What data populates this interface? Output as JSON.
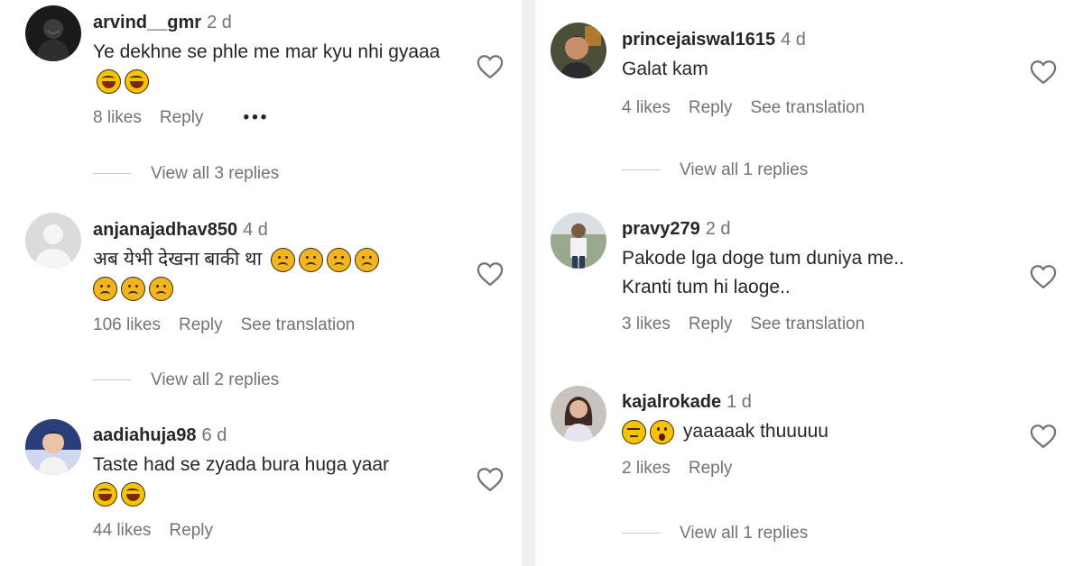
{
  "left": {
    "comments": [
      {
        "username": "arvind__gmr",
        "time": "2 d",
        "text": "Ye dekhne se phle me mar kyu nhi gyaaa",
        "emojis": [
          "laugh-emoji",
          "laugh-emoji"
        ],
        "likes": "8 likes",
        "reply": "Reply",
        "more": "•••",
        "view_replies": "View all 3 replies"
      },
      {
        "username": "anjanajadhav850",
        "time": "4 d",
        "text": "अब येभी देखना बाकी था",
        "emojis": [
          "sad-emoji",
          "sad-emoji",
          "sad-emoji",
          "sad-emoji",
          "sad-emoji",
          "sad-emoji",
          "sad-emoji"
        ],
        "likes": "106 likes",
        "reply": "Reply",
        "see_translation": "See translation",
        "view_replies": "View all 2 replies"
      },
      {
        "username": "aadiahuja98",
        "time": "6 d",
        "text": "Taste had se zyada bura huga yaar",
        "emojis": [
          "laugh-emoji",
          "laugh-emoji"
        ],
        "likes": "44 likes",
        "reply": "Reply"
      }
    ]
  },
  "right": {
    "comments": [
      {
        "username": "princejaiswal1615",
        "time": "4 d",
        "text": "Galat kam",
        "likes": "4 likes",
        "reply": "Reply",
        "see_translation": "See translation",
        "view_replies": "View all 1 replies"
      },
      {
        "username": "pravy279",
        "time": "2 d",
        "text_line1": "Pakode lga doge tum duniya me..",
        "text_line2": "Kranti tum hi laoge..",
        "likes": "3 likes",
        "reply": "Reply",
        "see_translation": "See translation"
      },
      {
        "username": "kajalrokade",
        "time": "1 d",
        "text": "yaaaaak thuuuuu",
        "emojis": [
          "unamused-emoji",
          "hushed-emoji"
        ],
        "likes": "2 likes",
        "reply": "Reply",
        "view_replies": "View all 1 replies"
      }
    ]
  },
  "colors": {
    "text": "#262626",
    "secondary": "#737373",
    "divider": "#c7c7c7",
    "background": "#efefef"
  }
}
